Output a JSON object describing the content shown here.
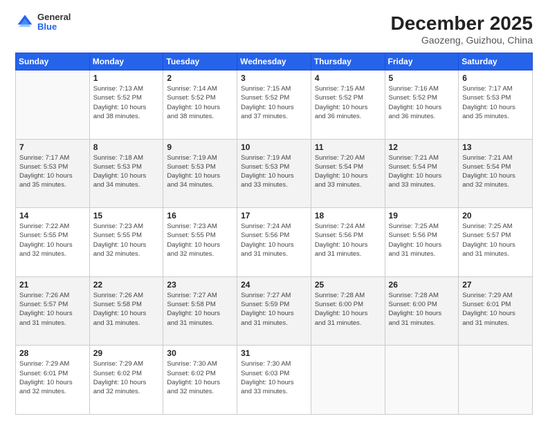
{
  "header": {
    "logo_general": "General",
    "logo_blue": "Blue",
    "title": "December 2025",
    "subtitle": "Gaozeng, Guizhou, China"
  },
  "weekdays": [
    "Sunday",
    "Monday",
    "Tuesday",
    "Wednesday",
    "Thursday",
    "Friday",
    "Saturday"
  ],
  "weeks": [
    [
      {
        "day": "",
        "info": ""
      },
      {
        "day": "1",
        "info": "Sunrise: 7:13 AM\nSunset: 5:52 PM\nDaylight: 10 hours\nand 38 minutes."
      },
      {
        "day": "2",
        "info": "Sunrise: 7:14 AM\nSunset: 5:52 PM\nDaylight: 10 hours\nand 38 minutes."
      },
      {
        "day": "3",
        "info": "Sunrise: 7:15 AM\nSunset: 5:52 PM\nDaylight: 10 hours\nand 37 minutes."
      },
      {
        "day": "4",
        "info": "Sunrise: 7:15 AM\nSunset: 5:52 PM\nDaylight: 10 hours\nand 36 minutes."
      },
      {
        "day": "5",
        "info": "Sunrise: 7:16 AM\nSunset: 5:52 PM\nDaylight: 10 hours\nand 36 minutes."
      },
      {
        "day": "6",
        "info": "Sunrise: 7:17 AM\nSunset: 5:53 PM\nDaylight: 10 hours\nand 35 minutes."
      }
    ],
    [
      {
        "day": "7",
        "info": "Sunrise: 7:17 AM\nSunset: 5:53 PM\nDaylight: 10 hours\nand 35 minutes."
      },
      {
        "day": "8",
        "info": "Sunrise: 7:18 AM\nSunset: 5:53 PM\nDaylight: 10 hours\nand 34 minutes."
      },
      {
        "day": "9",
        "info": "Sunrise: 7:19 AM\nSunset: 5:53 PM\nDaylight: 10 hours\nand 34 minutes."
      },
      {
        "day": "10",
        "info": "Sunrise: 7:19 AM\nSunset: 5:53 PM\nDaylight: 10 hours\nand 33 minutes."
      },
      {
        "day": "11",
        "info": "Sunrise: 7:20 AM\nSunset: 5:54 PM\nDaylight: 10 hours\nand 33 minutes."
      },
      {
        "day": "12",
        "info": "Sunrise: 7:21 AM\nSunset: 5:54 PM\nDaylight: 10 hours\nand 33 minutes."
      },
      {
        "day": "13",
        "info": "Sunrise: 7:21 AM\nSunset: 5:54 PM\nDaylight: 10 hours\nand 32 minutes."
      }
    ],
    [
      {
        "day": "14",
        "info": "Sunrise: 7:22 AM\nSunset: 5:55 PM\nDaylight: 10 hours\nand 32 minutes."
      },
      {
        "day": "15",
        "info": "Sunrise: 7:23 AM\nSunset: 5:55 PM\nDaylight: 10 hours\nand 32 minutes."
      },
      {
        "day": "16",
        "info": "Sunrise: 7:23 AM\nSunset: 5:55 PM\nDaylight: 10 hours\nand 32 minutes."
      },
      {
        "day": "17",
        "info": "Sunrise: 7:24 AM\nSunset: 5:56 PM\nDaylight: 10 hours\nand 31 minutes."
      },
      {
        "day": "18",
        "info": "Sunrise: 7:24 AM\nSunset: 5:56 PM\nDaylight: 10 hours\nand 31 minutes."
      },
      {
        "day": "19",
        "info": "Sunrise: 7:25 AM\nSunset: 5:56 PM\nDaylight: 10 hours\nand 31 minutes."
      },
      {
        "day": "20",
        "info": "Sunrise: 7:25 AM\nSunset: 5:57 PM\nDaylight: 10 hours\nand 31 minutes."
      }
    ],
    [
      {
        "day": "21",
        "info": "Sunrise: 7:26 AM\nSunset: 5:57 PM\nDaylight: 10 hours\nand 31 minutes."
      },
      {
        "day": "22",
        "info": "Sunrise: 7:26 AM\nSunset: 5:58 PM\nDaylight: 10 hours\nand 31 minutes."
      },
      {
        "day": "23",
        "info": "Sunrise: 7:27 AM\nSunset: 5:58 PM\nDaylight: 10 hours\nand 31 minutes."
      },
      {
        "day": "24",
        "info": "Sunrise: 7:27 AM\nSunset: 5:59 PM\nDaylight: 10 hours\nand 31 minutes."
      },
      {
        "day": "25",
        "info": "Sunrise: 7:28 AM\nSunset: 6:00 PM\nDaylight: 10 hours\nand 31 minutes."
      },
      {
        "day": "26",
        "info": "Sunrise: 7:28 AM\nSunset: 6:00 PM\nDaylight: 10 hours\nand 31 minutes."
      },
      {
        "day": "27",
        "info": "Sunrise: 7:29 AM\nSunset: 6:01 PM\nDaylight: 10 hours\nand 31 minutes."
      }
    ],
    [
      {
        "day": "28",
        "info": "Sunrise: 7:29 AM\nSunset: 6:01 PM\nDaylight: 10 hours\nand 32 minutes."
      },
      {
        "day": "29",
        "info": "Sunrise: 7:29 AM\nSunset: 6:02 PM\nDaylight: 10 hours\nand 32 minutes."
      },
      {
        "day": "30",
        "info": "Sunrise: 7:30 AM\nSunset: 6:02 PM\nDaylight: 10 hours\nand 32 minutes."
      },
      {
        "day": "31",
        "info": "Sunrise: 7:30 AM\nSunset: 6:03 PM\nDaylight: 10 hours\nand 33 minutes."
      },
      {
        "day": "",
        "info": ""
      },
      {
        "day": "",
        "info": ""
      },
      {
        "day": "",
        "info": ""
      }
    ]
  ]
}
